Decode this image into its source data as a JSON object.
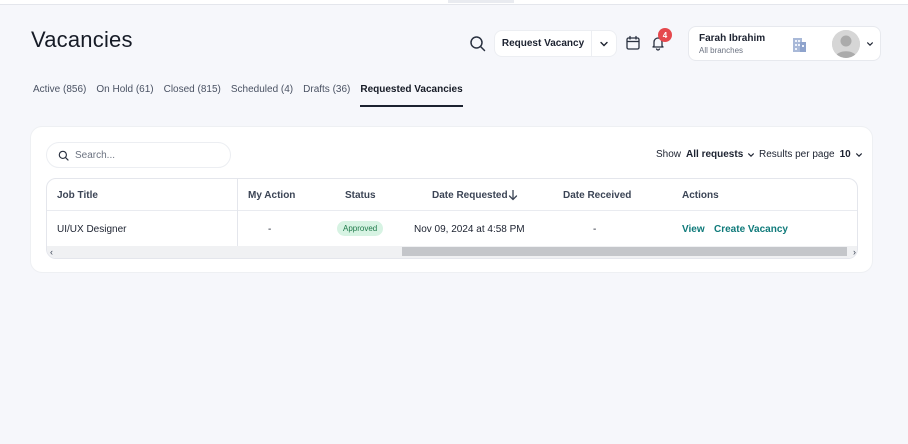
{
  "page": {
    "title": "Vacancies"
  },
  "header": {
    "request_button_label": "Request Vacancy",
    "notifications_count": "4",
    "user": {
      "name": "Farah Ibrahim",
      "subtitle": "All branches"
    }
  },
  "tabs": [
    {
      "label": "Active (856)"
    },
    {
      "label": "On Hold (61)"
    },
    {
      "label": "Closed (815)"
    },
    {
      "label": "Scheduled (4)"
    },
    {
      "label": "Drafts (36)"
    },
    {
      "label": "Requested Vacancies",
      "active": true
    }
  ],
  "toolbar": {
    "search_placeholder": "Search...",
    "show_label": "Show",
    "show_value": "All requests",
    "per_page_label": "Results per page",
    "per_page_value": "10"
  },
  "table": {
    "columns": [
      "Job Title",
      "My Action",
      "Status",
      "Date Requested",
      "Date Received",
      "Actions"
    ],
    "rows": [
      {
        "job_title": "UI/UX Designer",
        "my_action": "-",
        "status": "Approved",
        "date_requested": "Nov 09, 2024 at 4:58 PM",
        "date_received": "-",
        "action_view": "View",
        "action_create": "Create Vacancy"
      }
    ]
  },
  "colors": {
    "accent": "#0f7a7a",
    "badge_bg": "#d7f3e3",
    "badge_text": "#1f7a4a",
    "notification": "#e5484d"
  }
}
